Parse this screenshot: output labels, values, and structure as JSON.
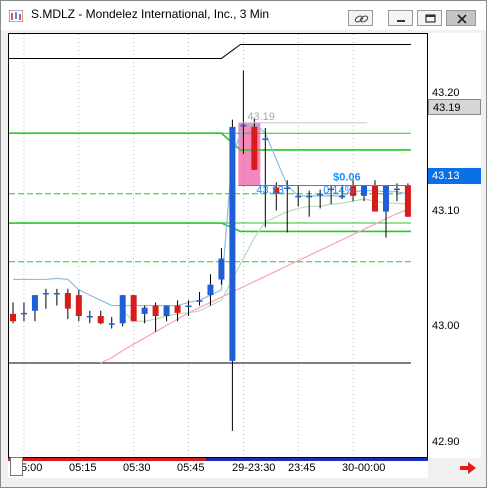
{
  "window": {
    "title": "S.MDLZ - Mondelez International, Inc., 3 Min",
    "buttons": [
      "link-icon",
      "minimize-icon",
      "restore-icon",
      "close-icon"
    ]
  },
  "chart_data": {
    "type": "candlestick",
    "symbol": "S.MDLZ",
    "timeframe": "3 Min",
    "ylim": [
      42.87,
      43.275
    ],
    "y_ticks": [
      "43.20",
      "43.10",
      "43.00",
      "42.90"
    ],
    "x_ticks": [
      "5:00",
      "05:15",
      "05:30",
      "05:45",
      "29-23:30",
      "23:45",
      "30-00:00"
    ],
    "last_price": "43.13",
    "marker_price": "43.19",
    "annotations": {
      "high_label": "43.19",
      "low_label": "43.13",
      "pnl_label": "$0.06",
      "pct_label": "0.14%"
    },
    "levels": [
      {
        "value": 43.265,
        "color": "#000000",
        "style": "solid",
        "start_bar": 20
      },
      {
        "value": 43.18,
        "color": "#22cc22",
        "style": "solid"
      },
      {
        "value": 43.164,
        "color": "#22cc22",
        "style": "solid",
        "start_bar": 20
      },
      {
        "value": 43.122,
        "color": "#22cc22",
        "style": "dashed"
      },
      {
        "value": 43.094,
        "color": "#22cc22",
        "style": "solid"
      },
      {
        "value": 43.086,
        "color": "#22cc22",
        "style": "solid",
        "start_bar": 20
      },
      {
        "value": 43.057,
        "color": "#22cc22",
        "style": "dashed"
      },
      {
        "value": 42.96,
        "color": "#000000",
        "style": "solid"
      }
    ],
    "candles": [
      {
        "o": 43.007,
        "h": 43.018,
        "l": 42.998,
        "c": 43.0
      },
      {
        "o": 43.008,
        "h": 43.018,
        "l": 43.0,
        "c": 43.008
      },
      {
        "o": 43.01,
        "h": 43.025,
        "l": 43.0,
        "c": 43.025
      },
      {
        "o": 43.027,
        "h": 43.031,
        "l": 43.012,
        "c": 43.027
      },
      {
        "o": 43.027,
        "h": 43.031,
        "l": 43.015,
        "c": 43.027
      },
      {
        "o": 43.027,
        "h": 43.031,
        "l": 43.002,
        "c": 43.012
      },
      {
        "o": 43.025,
        "h": 43.03,
        "l": 43.0,
        "c": 43.005
      },
      {
        "o": 43.005,
        "h": 43.01,
        "l": 42.998,
        "c": 43.005
      },
      {
        "o": 43.005,
        "h": 43.01,
        "l": 42.997,
        "c": 42.998
      },
      {
        "o": 42.998,
        "h": 43.004,
        "l": 42.993,
        "c": 42.998
      },
      {
        "o": 42.998,
        "h": 43.025,
        "l": 42.995,
        "c": 43.025
      },
      {
        "o": 43.025,
        "h": 43.025,
        "l": 43.0,
        "c": 43.0
      },
      {
        "o": 43.007,
        "h": 43.015,
        "l": 42.998,
        "c": 43.013
      },
      {
        "o": 43.015,
        "h": 43.018,
        "l": 42.99,
        "c": 43.005
      },
      {
        "o": 43.005,
        "h": 43.015,
        "l": 43.0,
        "c": 43.015
      },
      {
        "o": 43.015,
        "h": 43.02,
        "l": 43.0,
        "c": 43.008
      },
      {
        "o": 43.015,
        "h": 43.02,
        "l": 43.005,
        "c": 43.015
      },
      {
        "o": 43.02,
        "h": 43.028,
        "l": 43.015,
        "c": 43.02
      },
      {
        "o": 43.025,
        "h": 43.045,
        "l": 43.015,
        "c": 43.035
      },
      {
        "o": 43.04,
        "h": 43.07,
        "l": 43.035,
        "c": 43.06
      },
      {
        "o": 42.962,
        "h": 43.193,
        "l": 42.895,
        "c": 43.186
      },
      {
        "o": 43.188,
        "h": 43.24,
        "l": 43.16,
        "c": 43.188
      },
      {
        "o": 43.186,
        "h": 43.195,
        "l": 43.145,
        "c": 43.145
      },
      {
        "o": 43.175,
        "h": 43.185,
        "l": 43.09,
        "c": 43.175
      },
      {
        "o": 43.128,
        "h": 43.133,
        "l": 43.106,
        "c": 43.122
      },
      {
        "o": 43.128,
        "h": 43.135,
        "l": 43.085,
        "c": 43.128
      },
      {
        "o": 43.12,
        "h": 43.13,
        "l": 43.11,
        "c": 43.12
      },
      {
        "o": 43.12,
        "h": 43.125,
        "l": 43.1,
        "c": 43.12
      },
      {
        "o": 43.122,
        "h": 43.126,
        "l": 43.108,
        "c": 43.122
      },
      {
        "o": 43.127,
        "h": 43.13,
        "l": 43.112,
        "c": 43.127
      },
      {
        "o": 43.12,
        "h": 43.13,
        "l": 43.117,
        "c": 43.12
      },
      {
        "o": 43.13,
        "h": 43.135,
        "l": 43.115,
        "c": 43.12
      },
      {
        "o": 43.12,
        "h": 43.13,
        "l": 43.115,
        "c": 43.13
      },
      {
        "o": 43.13,
        "h": 43.135,
        "l": 43.105,
        "c": 43.105
      },
      {
        "o": 43.105,
        "h": 43.13,
        "l": 43.08,
        "c": 43.13
      },
      {
        "o": 43.127,
        "h": 43.132,
        "l": 43.115,
        "c": 43.127
      },
      {
        "o": 43.13,
        "h": 43.132,
        "l": 43.1,
        "c": 43.1
      }
    ],
    "ma_fast": [
      43.04,
      43.04,
      43.04,
      43.04,
      43.041,
      43.04,
      43.03,
      43.025,
      43.02,
      43.015,
      43.015,
      43.015,
      43.015,
      43.015,
      43.015,
      43.015,
      43.018,
      43.02,
      43.025,
      43.03,
      43.16,
      43.185,
      43.19,
      43.18,
      43.155,
      43.13,
      43.12,
      43.12,
      43.12,
      43.12,
      43.12,
      43.124,
      43.125,
      43.125,
      43.124,
      43.124,
      43.122
    ],
    "ma_mid": [
      null,
      null,
      null,
      null,
      null,
      null,
      null,
      null,
      null,
      null,
      43.01,
      43.0,
      43.0,
      43.002,
      43.005,
      43.007,
      43.008,
      43.01,
      43.015,
      43.02,
      43.04,
      43.06,
      43.08,
      43.095,
      43.1,
      43.105,
      43.108,
      43.11,
      43.11,
      43.112,
      43.113,
      43.115,
      43.117,
      43.115,
      43.113,
      43.113,
      43.112
    ],
    "ma_slow": [
      null,
      null,
      null,
      null,
      null,
      null,
      null,
      null,
      42.96,
      42.965,
      42.972,
      42.978,
      42.984,
      42.99,
      42.996,
      43.002,
      43.008,
      43.013,
      43.018,
      43.023,
      43.028,
      43.033,
      43.038,
      43.043,
      43.048,
      43.053,
      43.058,
      43.063,
      43.068,
      43.073,
      43.078,
      43.083,
      43.088,
      43.093,
      43.098,
      43.103,
      43.107
    ],
    "highlight_bars": [
      21,
      22
    ],
    "colors": {
      "up": "#1f5fd6",
      "down": "#d81b1b",
      "ma_fast": "#8fbbe6",
      "ma_mid": "#b8dcb8",
      "ma_slow": "#f7a0bf",
      "levels": "#22cc22",
      "highlight": "#f060a8",
      "annotation": "#1a8cff",
      "price_box": "#0a6fe8"
    }
  }
}
